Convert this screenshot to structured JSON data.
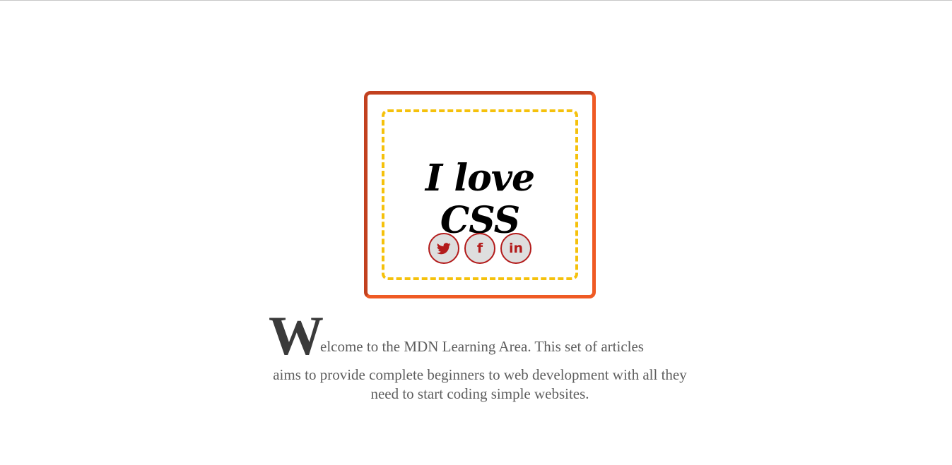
{
  "card": {
    "title": "I love CSS",
    "socials": [
      {
        "name": "twitter",
        "icon": "twitter-bird-icon"
      },
      {
        "name": "facebook",
        "icon": "facebook-f-icon",
        "glyph": "f"
      },
      {
        "name": "linkedin",
        "icon": "linkedin-in-icon",
        "glyph": "in"
      }
    ],
    "colors": {
      "outer_border": "#c2411f",
      "outer_border_alt": "#ef5a24",
      "inner_border": "#f5c10c",
      "icon": "#b31b1b",
      "icon_bg": "#dedede"
    }
  },
  "intro": {
    "dropcap": "W",
    "first_line_rest": "elcome to the MDN Learning Area. This set of articles",
    "rest": "aims to provide complete beginners to web development with all they need to start coding simple websites."
  }
}
